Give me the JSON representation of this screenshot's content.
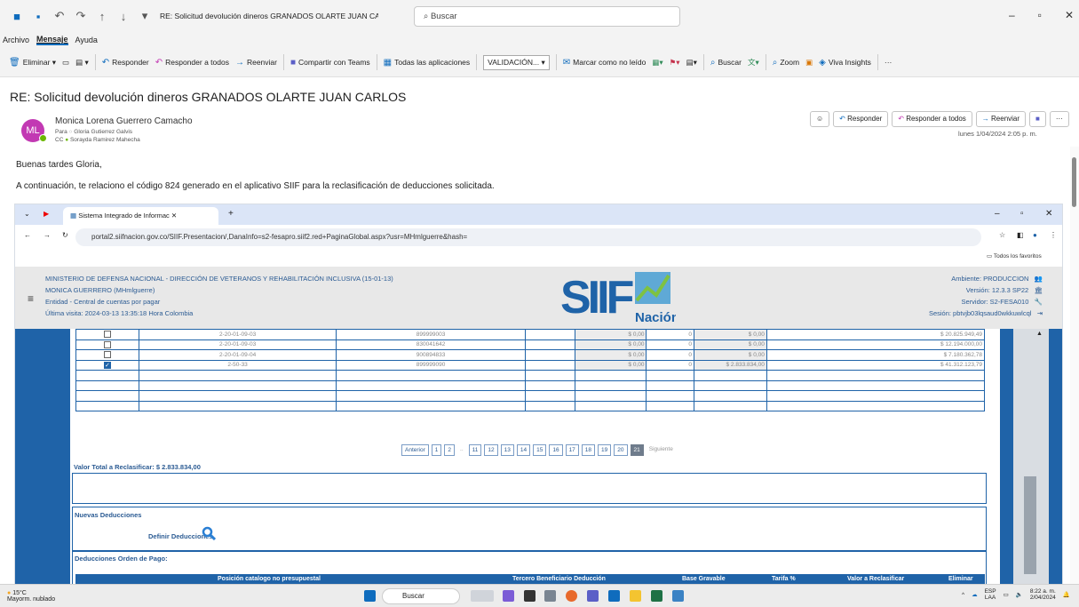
{
  "window": {
    "title": "RE: Solicitud devolución dineros GRANADOS OLARTE JUAN CARLOS  -  Mensaje (HTML)",
    "search_placeholder": "Buscar",
    "controls": [
      "–",
      "▫",
      "✕"
    ]
  },
  "menu": [
    "Archivo",
    "Mensaje",
    "Ayuda"
  ],
  "ribbon": {
    "eliminar": "Eliminar",
    "responder": "Responder",
    "responder_todos": "Responder a todos",
    "reenviar": "Reenviar",
    "compartir_teams": "Compartir con Teams",
    "todas_apps": "Todas las aplicaciones",
    "validacion": "VALIDACIÓN...",
    "marcar": "Marcar como no leído",
    "buscar": "Buscar",
    "zoom": "Zoom",
    "viva": "Viva Insights",
    "more": "···"
  },
  "message": {
    "subject": "RE: Solicitud devolución dineros GRANADOS OLARTE JUAN CARLOS",
    "avatar": "ML",
    "sender": "Monica Lorena Guerrero Camacho",
    "to_label": "Para",
    "to": "Gloria Gutierrez Galvis",
    "cc_label": "CC",
    "cc": "Sorayda Ramirez Mahecha",
    "date": "lunes 1/04/2024 2:05 p. m.",
    "actions": {
      "responder": "Responder",
      "responder_todos": "Responder a todos",
      "reenviar": "Reenviar",
      "more": "···"
    },
    "greeting": "Buenas tardes Gloria,",
    "intro": "A continuación, te relaciono el código 824 generado en el aplicativo SIIF para la reclasificación de deducciones solicitada."
  },
  "browser": {
    "tab_title": "Sistema Integrado de Informac",
    "url": "portal2.siifnacion.gov.co/SIIF.Presentacion/,DanaInfo=s2-fesapro.siif2.red+PaginaGlobal.aspx?usr=MHmlguerre&hash=",
    "bookmarks": "Todos los favoritos"
  },
  "siif": {
    "entity_line": "MINISTERIO DE DEFENSA NACIONAL - DIRECCIÓN DE VETERANOS Y REHABILITACIÓN INCLUSIVA (15-01-13)",
    "user": "MONICA GUERRERO (MHmlguerre)",
    "entidad": "Entidad - Central de cuentas por pagar",
    "ultima": "Última visita: 2024-03-13 13:35:18 Hora Colombia",
    "logo_main": "SIIF",
    "logo_sub": "Nación",
    "ambiente": "Ambiente: PRODUCCION",
    "version": "Versión: 12.3.3 SP22",
    "servidor": "Servidor: S2-FESA010",
    "sesion": "Sesión: pbtvjb03lqsaud0wkkuwlcql"
  },
  "rows": [
    {
      "checked": false,
      "code": "2-20-01-09-03",
      "nit": "899999003",
      "v1": "$ 0,00",
      "n": "0",
      "v2": "$ 0,00",
      "total": "$ 20.825.949,49"
    },
    {
      "checked": false,
      "code": "2-20-01-09-03",
      "nit": "830041642",
      "v1": "$ 0,00",
      "n": "0",
      "v2": "$ 0,00",
      "total": "$ 12.194.000,00"
    },
    {
      "checked": false,
      "code": "2-20-01-09-04",
      "nit": "900894833",
      "v1": "$ 0,00",
      "n": "0",
      "v2": "$ 0,00",
      "total": "$ 7.180.362,78"
    },
    {
      "checked": true,
      "code": "2-50-33",
      "nit": "899999090",
      "v1": "$ 0,00",
      "n": "0",
      "v2": "$ 2.833.834,00",
      "total": "$ 41.312.123,79"
    }
  ],
  "pager": {
    "prev": "Anterior",
    "pages": [
      "1",
      "2",
      "..",
      "11",
      "12",
      "13",
      "14",
      "15",
      "16",
      "17",
      "18",
      "19",
      "20",
      "21"
    ],
    "current": "21",
    "next": "Siguiente"
  },
  "valor_total": "Valor Total a Reclasificar: $ 2.833.834,00",
  "nuevas": "Nuevas Deducciones",
  "definir": "Definir Deducciones",
  "orden": "Deducciones Orden de Pago:",
  "deduc_headers": [
    "Posición catalogo no presupuestal",
    "Tercero Beneficiario Deducción",
    "Base Gravable",
    "Tarifa %",
    "Valor a Reclasificar",
    "Eliminar"
  ],
  "taskbar": {
    "temp": "15°C",
    "weather": "Mayorm. nublado",
    "search": "Buscar",
    "lang1": "ESP",
    "lang2": "LAA",
    "time": "8:22 a. m.",
    "date": "2/04/2024"
  },
  "colors": {
    "siif_blue": "#1f63a8",
    "outlook_blue": "#0f6cbd",
    "avatar": "#c239b3"
  }
}
